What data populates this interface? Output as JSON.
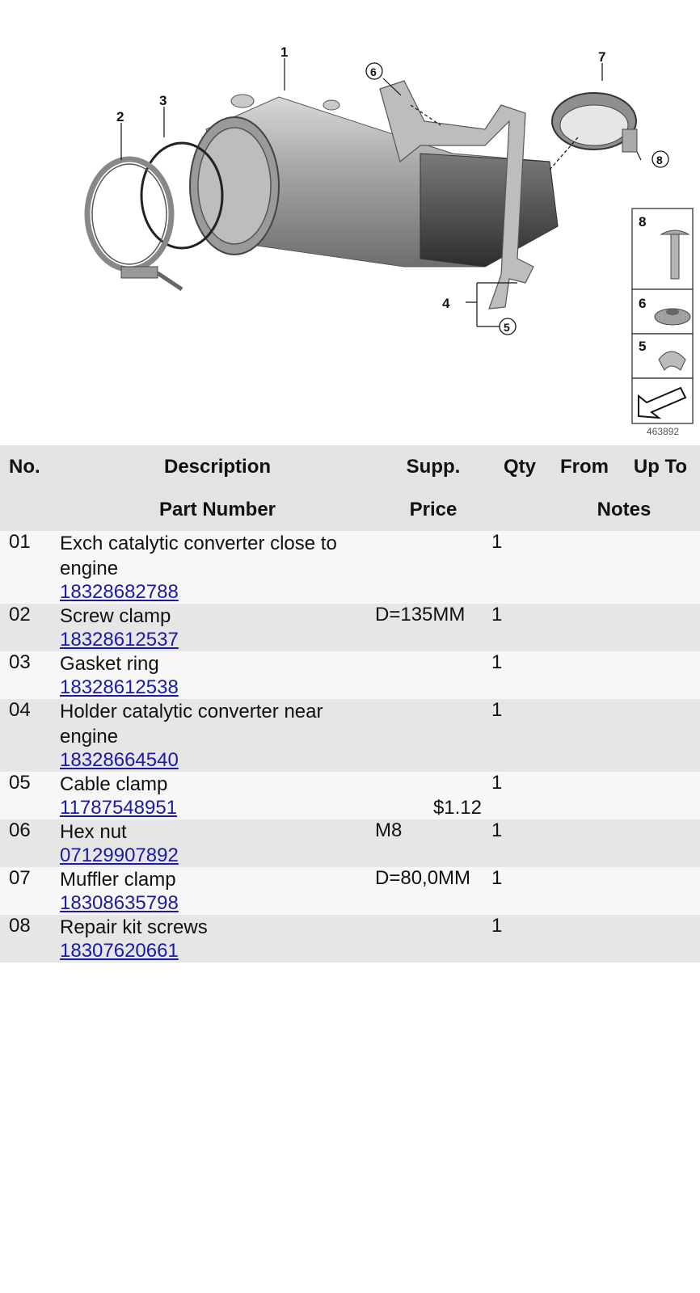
{
  "diagram": {
    "callouts": [
      "1",
      "2",
      "3",
      "4",
      "5",
      "6",
      "7",
      "8"
    ],
    "inset_labels": [
      "8",
      "6",
      "5"
    ],
    "reference_number": "463892"
  },
  "table": {
    "headers_row1": {
      "no": "No.",
      "description": "Description",
      "supp": "Supp.",
      "qty": "Qty",
      "from": "From",
      "up_to": "Up To"
    },
    "headers_row2": {
      "part_number": "Part Number",
      "price": "Price",
      "notes": "Notes"
    },
    "rows": [
      {
        "no": "01",
        "description": "Exch catalytic converter close to engine",
        "supp": "",
        "qty": "1",
        "part_number": "18328682788",
        "price": ""
      },
      {
        "no": "02",
        "description": "Screw clamp",
        "supp": "D=135MM",
        "qty": "1",
        "part_number": "18328612537",
        "price": ""
      },
      {
        "no": "03",
        "description": "Gasket ring",
        "supp": "",
        "qty": "1",
        "part_number": "18328612538",
        "price": ""
      },
      {
        "no": "04",
        "description": "Holder catalytic converter near engine",
        "supp": "",
        "qty": "1",
        "part_number": "18328664540",
        "price": ""
      },
      {
        "no": "05",
        "description": "Cable clamp",
        "supp": "",
        "qty": "1",
        "part_number": "11787548951",
        "price": "$1.12"
      },
      {
        "no": "06",
        "description": "Hex nut",
        "supp": "M8",
        "qty": "1",
        "part_number": "07129907892",
        "price": ""
      },
      {
        "no": "07",
        "description": "Muffler clamp",
        "supp": "D=80,0MM",
        "qty": "1",
        "part_number": "18308635798",
        "price": ""
      },
      {
        "no": "08",
        "description": "Repair kit screws",
        "supp": "",
        "qty": "1",
        "part_number": "18307620661",
        "price": ""
      }
    ]
  }
}
